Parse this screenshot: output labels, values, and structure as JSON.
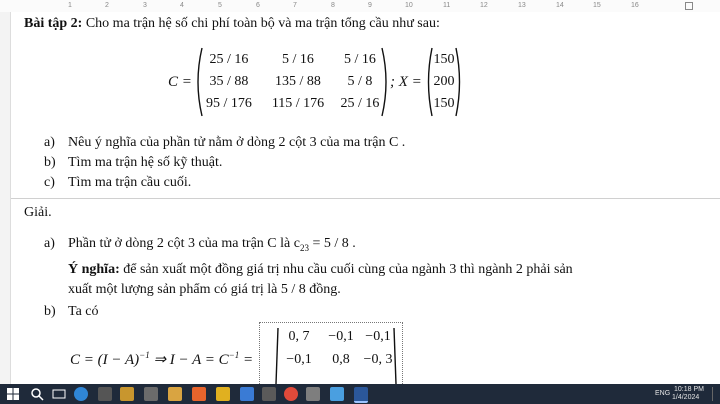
{
  "ruler": {
    "ticks": [
      "1",
      "2",
      "3",
      "4",
      "5",
      "6",
      "7",
      "8",
      "9",
      "10",
      "11",
      "12",
      "13",
      "14",
      "15",
      "16"
    ]
  },
  "problem": {
    "heading": "Bài tập 2:",
    "intro": "Cho ma trận hệ số chi phí toàn bộ và ma trận tổng cầu như sau:",
    "c_label": "C =",
    "x_label": "; X =",
    "c_matrix": [
      [
        "25 / 16",
        "5 / 16",
        "5 / 16"
      ],
      [
        "35 / 88",
        "135 / 88",
        "5 / 8"
      ],
      [
        "95 / 176",
        "115 / 176",
        "25 / 16"
      ]
    ],
    "x_matrix": [
      "150",
      "200",
      "150"
    ],
    "questions": [
      {
        "label": "a)",
        "text": "Nêu ý nghĩa của phần tử nằm ở dòng 2 cột 3 của ma trận C ."
      },
      {
        "label": "b)",
        "text": "Tìm ma trận hệ số kỹ thuật."
      },
      {
        "label": "c)",
        "text": "Tìm ma trận cầu cuối."
      }
    ]
  },
  "solution": {
    "heading": "Giải.",
    "a_label": "a)",
    "a_text": "Phần tử ở dòng 2 cột 3 của ma trận C  là c",
    "a_sub": "23",
    "a_eq": " = 5 / 8 .",
    "meaning_label": "Ý nghĩa:",
    "meaning_text1": " để sản xuất một đồng giá trị nhu cầu cuối cùng của ngành 3 thì ngành 2 phải sản",
    "meaning_text2": "xuất một lượng sản phẩm có giá trị là  5 / 8  đồng.",
    "b_label": "b)",
    "b_text": "Ta có",
    "formula_left": "C = (I − A)",
    "formula_exp": "−1",
    "formula_mid": "⇒ I − A = C",
    "formula_mid_exp": "−1",
    "formula_eq": "=",
    "result_matrix": [
      [
        "0, 7",
        "−0,1",
        "−0,1"
      ],
      [
        "−0,1",
        "0,8",
        "−0, 3"
      ]
    ]
  },
  "taskbar": {
    "lang": "ENG",
    "time": "10:18 PM",
    "date": "1/4/2024"
  },
  "colors": {
    "taskbar": "#1f2a3a",
    "start": "#ffffff"
  }
}
